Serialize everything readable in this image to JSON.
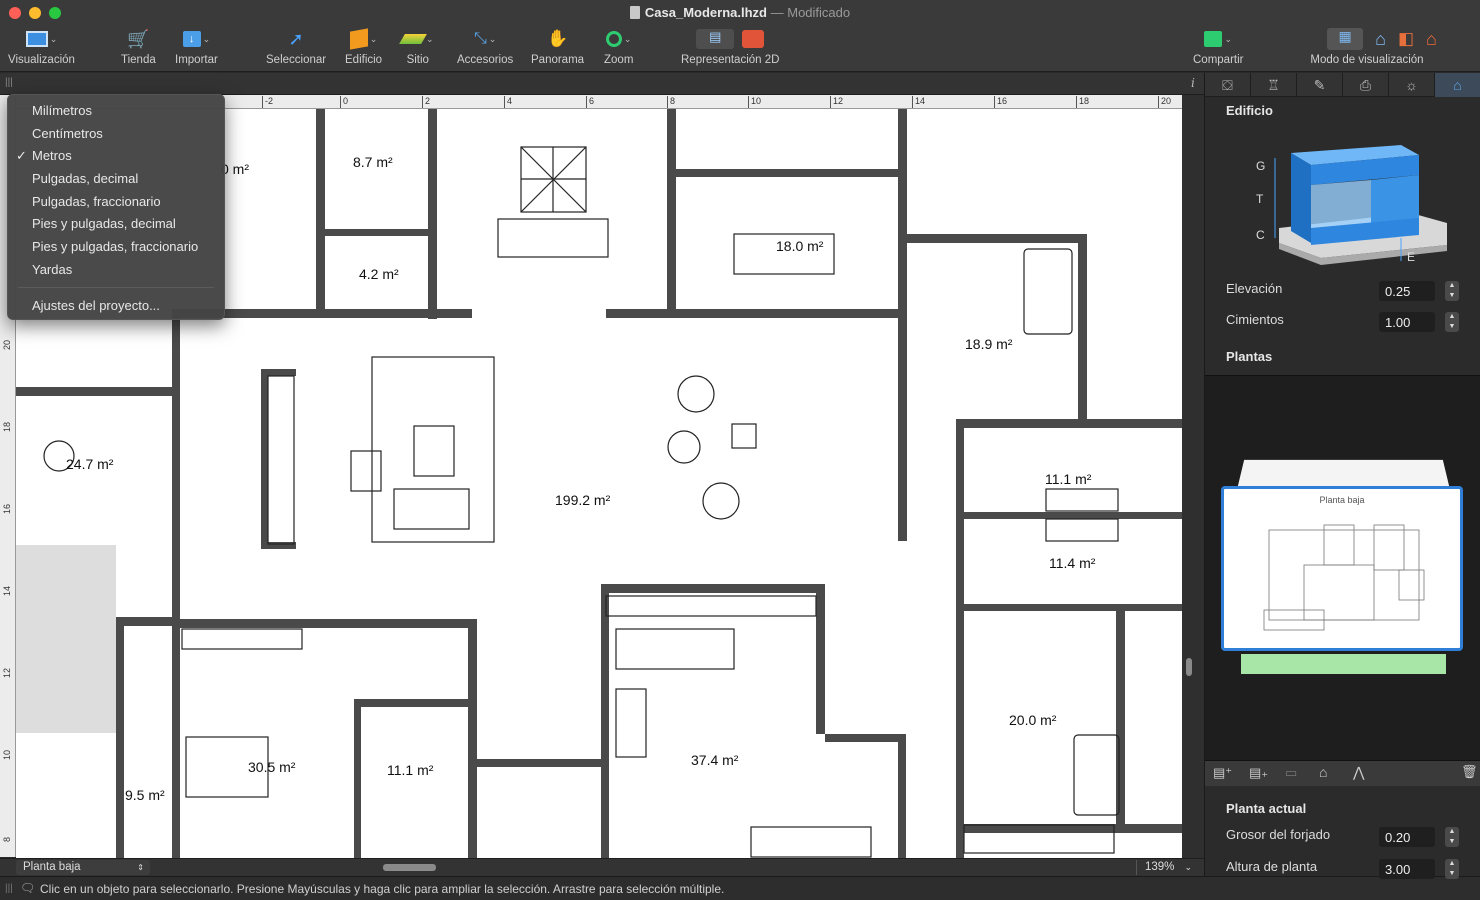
{
  "window": {
    "file_name": "Casa_Moderna.lhzd",
    "separator": "—",
    "status": "Modificado"
  },
  "toolbar": {
    "items": [
      {
        "label": "Visualización",
        "icon": "view-icon"
      },
      {
        "label": "Tienda",
        "icon": "cart-icon"
      },
      {
        "label": "Importar",
        "icon": "import-icon"
      },
      {
        "label": "Seleccionar",
        "icon": "cursor-icon"
      },
      {
        "label": "Edificio",
        "icon": "building-icon"
      },
      {
        "label": "Sitio",
        "icon": "site-icon"
      },
      {
        "label": "Accesorios",
        "icon": "accessories-icon"
      },
      {
        "label": "Panorama",
        "icon": "hand-icon"
      },
      {
        "label": "Zoom",
        "icon": "zoom-icon"
      },
      {
        "label": "Representación 2D",
        "icon": "printer-icon"
      },
      {
        "label": "Compartir",
        "icon": "share-icon"
      },
      {
        "label": "Modo de visualización",
        "icon": "view-mode-icon"
      }
    ]
  },
  "units_menu": {
    "items": [
      "Milímetros",
      "Centímetros",
      "Metros",
      "Pulgadas, decimal",
      "Pulgadas, fraccionario",
      "Pies y pulgadas, decimal",
      "Pies y pulgadas, fraccionario",
      "Yardas"
    ],
    "checked": "Metros",
    "check_mark": "✓",
    "project_settings": "Ajustes del proyecto..."
  },
  "ruler": {
    "top_ticks": [
      "-2",
      "0",
      "2",
      "4",
      "6",
      "8",
      "10",
      "12",
      "14",
      "16",
      "18",
      "20"
    ],
    "left_ticks": [
      "20",
      "18",
      "16",
      "14",
      "12",
      "10",
      "8"
    ]
  },
  "plan": {
    "areas": [
      "8.7 m²",
      "4.2 m²",
      "18.0 m²",
      "18.9 m²",
      "24.7 m²",
      "199.2 m²",
      "11.1 m²",
      "11.4 m²",
      "30.5 m²",
      "11.1 m²",
      "37.4 m²",
      "20.0 m²",
      "9.5 m²"
    ],
    "partial_area": "0 m²"
  },
  "bottom": {
    "floor_selector": "Planta baja",
    "zoom": "139%",
    "status_text": "Clic en un objeto para seleccionarlo. Presione Mayúsculas y haga clic para ampliar la selección. Arrastre para selección múltiple."
  },
  "panel": {
    "section_building": "Edificio",
    "diagram_labels": {
      "g": "G",
      "t": "T",
      "c": "C",
      "e": "E"
    },
    "elevation_label": "Elevación",
    "elevation_value": "0.25",
    "foundation_label": "Cimientos",
    "foundation_value": "1.00",
    "section_floors": "Plantas",
    "floor_card_title": "Planta baja",
    "section_current": "Planta actual",
    "slab_label": "Grosor del forjado",
    "slab_value": "0.20",
    "height_label": "Altura de planta",
    "height_value": "3.00"
  },
  "colors": {
    "accent": "#2f7fd8",
    "wall": "#4a4a4a",
    "panel_bg": "#2b2b2b"
  }
}
